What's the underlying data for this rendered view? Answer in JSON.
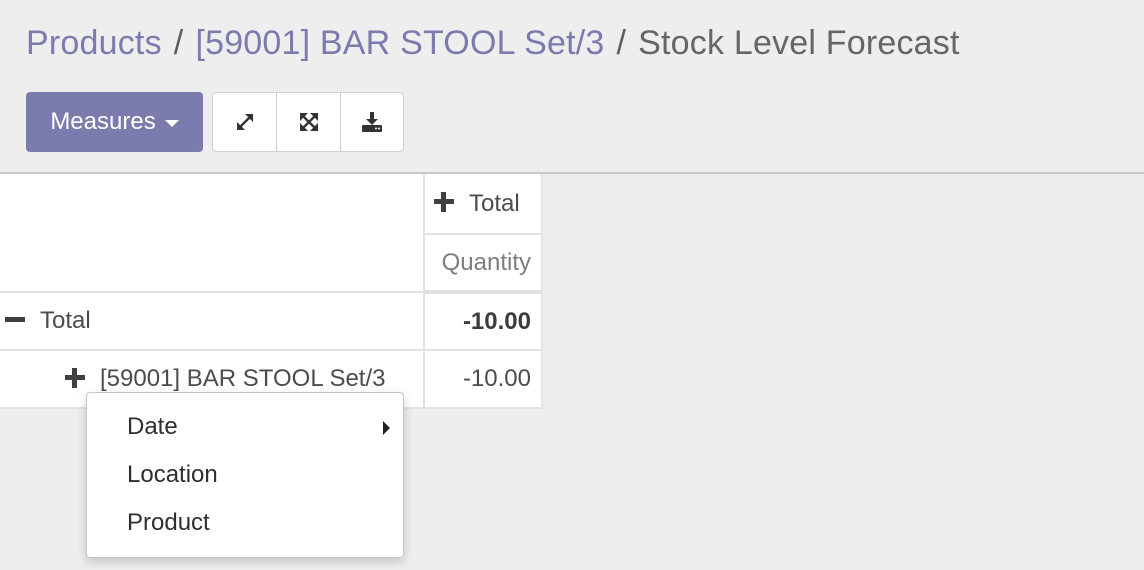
{
  "breadcrumb": {
    "items": [
      {
        "label": "Products",
        "link": true
      },
      {
        "label": "[59001] BAR STOOL Set/3",
        "link": true
      },
      {
        "label": "Stock Level Forecast",
        "link": false
      }
    ],
    "separator": "/"
  },
  "toolbar": {
    "measures_label": "Measures",
    "icons": [
      "expand-arrows-icon",
      "expand-all-icon",
      "download-icon"
    ]
  },
  "pivot": {
    "column_header": "Total",
    "measure_header": "Quantity",
    "rows": [
      {
        "label": "Total",
        "value": "-10.00",
        "sign": "minus"
      },
      {
        "label": "[59001] BAR STOOL Set/3",
        "value": "-10.00",
        "sign": "plus"
      }
    ]
  },
  "dropdown": {
    "items": [
      {
        "label": "Date",
        "has_submenu": true
      },
      {
        "label": "Location",
        "has_submenu": false
      },
      {
        "label": "Product",
        "has_submenu": false
      }
    ]
  },
  "colors": {
    "brand": "#7c7bad",
    "background": "#efeeef"
  }
}
